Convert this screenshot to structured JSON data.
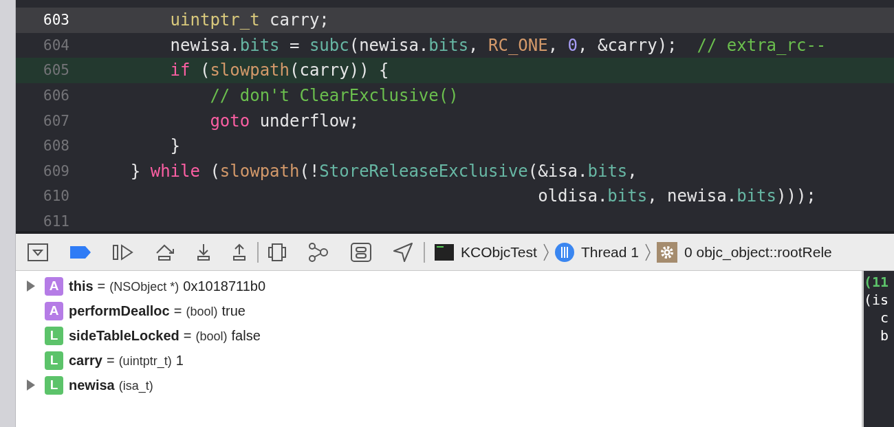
{
  "editor": {
    "lines": [
      {
        "number": "603",
        "current": true,
        "breakpoint": false,
        "tokens": [
          {
            "text": "        uintptr_t",
            "kind": "type"
          },
          {
            "text": " carry;",
            "kind": "plain"
          }
        ]
      },
      {
        "number": "604",
        "current": false,
        "breakpoint": false,
        "tokens": [
          {
            "text": "        newisa.",
            "kind": "plain"
          },
          {
            "text": "bits",
            "kind": "prop"
          },
          {
            "text": " = ",
            "kind": "plain"
          },
          {
            "text": "subc",
            "kind": "func"
          },
          {
            "text": "(newisa.",
            "kind": "plain"
          },
          {
            "text": "bits",
            "kind": "prop"
          },
          {
            "text": ", ",
            "kind": "plain"
          },
          {
            "text": "RC_ONE",
            "kind": "macro"
          },
          {
            "text": ", ",
            "kind": "plain"
          },
          {
            "text": "0",
            "kind": "num"
          },
          {
            "text": ", &carry);  ",
            "kind": "plain"
          },
          {
            "text": "// extra_rc--",
            "kind": "comment"
          }
        ]
      },
      {
        "number": "605",
        "current": false,
        "breakpoint": true,
        "tokens": [
          {
            "text": "        if",
            "kind": "keyword"
          },
          {
            "text": " (",
            "kind": "plain"
          },
          {
            "text": "slowpath",
            "kind": "macro"
          },
          {
            "text": "(carry)) {",
            "kind": "plain"
          }
        ]
      },
      {
        "number": "606",
        "current": false,
        "breakpoint": false,
        "tokens": [
          {
            "text": "            // don't ClearExclusive()",
            "kind": "comment"
          }
        ]
      },
      {
        "number": "607",
        "current": false,
        "breakpoint": false,
        "tokens": [
          {
            "text": "            goto",
            "kind": "keyword"
          },
          {
            "text": " underflow;",
            "kind": "plain"
          }
        ]
      },
      {
        "number": "608",
        "current": false,
        "breakpoint": false,
        "tokens": [
          {
            "text": "        }",
            "kind": "plain"
          }
        ]
      },
      {
        "number": "609",
        "current": false,
        "breakpoint": false,
        "tokens": [
          {
            "text": "    } ",
            "kind": "plain"
          },
          {
            "text": "while",
            "kind": "keyword"
          },
          {
            "text": " (",
            "kind": "plain"
          },
          {
            "text": "slowpath",
            "kind": "macro"
          },
          {
            "text": "(!",
            "kind": "plain"
          },
          {
            "text": "StoreReleaseExclusive",
            "kind": "func"
          },
          {
            "text": "(&isa.",
            "kind": "plain"
          },
          {
            "text": "bits",
            "kind": "prop"
          },
          {
            "text": ",",
            "kind": "plain"
          }
        ]
      },
      {
        "number": "610",
        "current": false,
        "breakpoint": false,
        "tokens": [
          {
            "text": "                                             oldisa.",
            "kind": "plain"
          },
          {
            "text": "bits",
            "kind": "prop"
          },
          {
            "text": ", newisa.",
            "kind": "plain"
          },
          {
            "text": "bits",
            "kind": "prop"
          },
          {
            "text": ")));",
            "kind": "plain"
          }
        ]
      },
      {
        "number": "611",
        "current": false,
        "breakpoint": false
      }
    ]
  },
  "debug_bar": {
    "breakpoints_active": true,
    "breadcrumbs": [
      {
        "kind": "app",
        "label": "KCObjcTest"
      },
      {
        "kind": "thread",
        "label": "Thread 1"
      },
      {
        "kind": "frame",
        "label": "0 objc_object::rootRele"
      }
    ]
  },
  "variables": [
    {
      "expandable": true,
      "badge": "A",
      "name": "this",
      "equals": "=",
      "type": "(NSObject *)",
      "value": "0x1018711b0"
    },
    {
      "expandable": false,
      "badge": "A",
      "name": "performDealloc",
      "equals": "=",
      "type": "(bool)",
      "value": "true"
    },
    {
      "expandable": false,
      "badge": "L",
      "name": "sideTableLocked",
      "equals": "=",
      "type": "(bool)",
      "value": "false"
    },
    {
      "expandable": false,
      "badge": "L",
      "name": "carry",
      "equals": "=",
      "type": "(uintptr_t)",
      "value": "1"
    },
    {
      "expandable": true,
      "badge": "L",
      "name": "newisa",
      "type": "(isa_t)"
    }
  ],
  "console": [
    {
      "text": "(11",
      "kind": "result"
    },
    {
      "text": "(is",
      "kind": "plain"
    },
    {
      "text": "  c",
      "kind": "plain"
    },
    {
      "text": "  b",
      "kind": "plain"
    }
  ]
}
